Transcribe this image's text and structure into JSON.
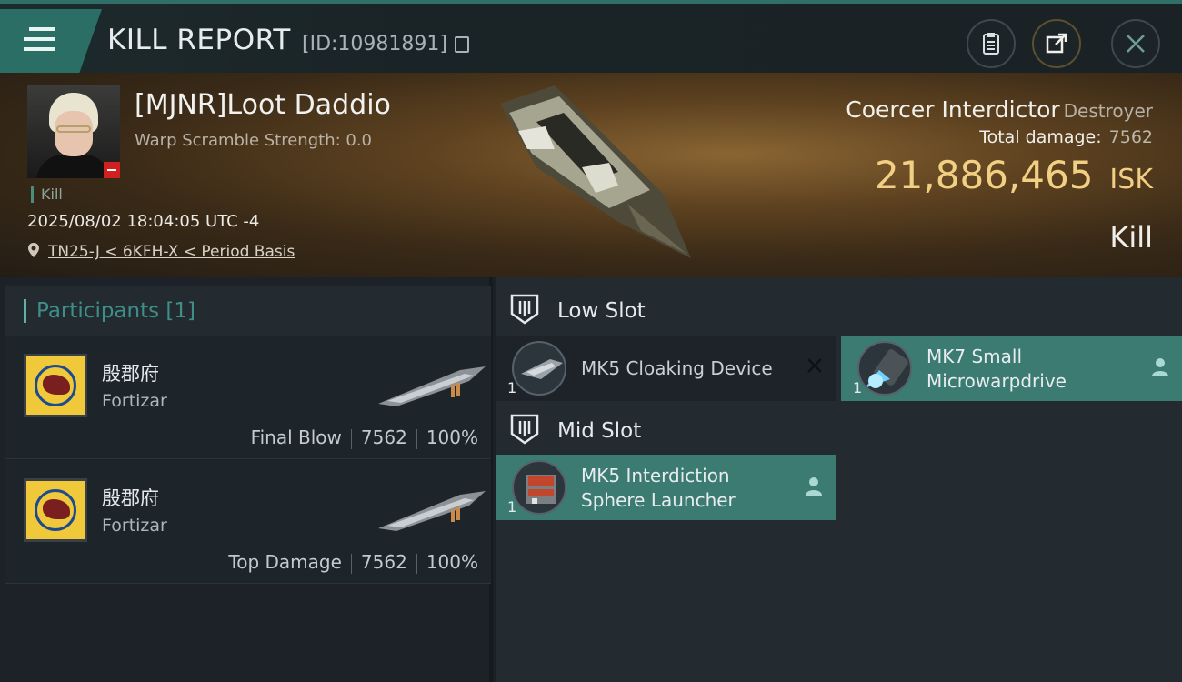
{
  "header": {
    "title": "KILL REPORT",
    "report_id": "[ID:10981891]"
  },
  "victim": {
    "pilot_name": "[MJNR]Loot Daddio",
    "warp_scramble": "Warp Scramble Strength: 0.0",
    "kill_tag": "Kill",
    "datetime": "2025/08/02 18:04:05 UTC -4",
    "location": "TN25-J < 6KFH-X < Period Basis",
    "ship_name": "Coercer Interdictor",
    "ship_class": "Destroyer",
    "total_damage_label": "Total damage:",
    "total_damage": "7562",
    "isk_value": "21,886,465",
    "isk_currency": "ISK",
    "result": "Kill"
  },
  "participants": {
    "title": "Participants [1]",
    "rows": [
      {
        "corp": "殷郡府",
        "ship": "Fortizar",
        "role": "Final Blow",
        "damage": "7562",
        "percent": "100%"
      },
      {
        "corp": "殷郡府",
        "ship": "Fortizar",
        "role": "Top Damage",
        "damage": "7562",
        "percent": "100%"
      }
    ]
  },
  "slots": {
    "low": {
      "title": "Low Slot",
      "modules": [
        {
          "qty": "1",
          "line1": "MK5 Cloaking Device",
          "line2": ""
        },
        {
          "qty": "1",
          "line1": "MK7 Small",
          "line2": "Microwarpdrive"
        }
      ]
    },
    "mid": {
      "title": "Mid Slot",
      "modules": [
        {
          "qty": "1",
          "line1": "MK5 Interdiction",
          "line2": "Sphere Launcher"
        }
      ]
    }
  },
  "colors": {
    "accent": "#3b7b72",
    "isk": "#f1d083",
    "corp_badge": "#f0c93a"
  },
  "icons": [
    "menu-icon",
    "clipboard-icon",
    "share-icon",
    "close-icon",
    "copy-icon",
    "location-pin-icon",
    "slot-icon",
    "person-icon"
  ]
}
